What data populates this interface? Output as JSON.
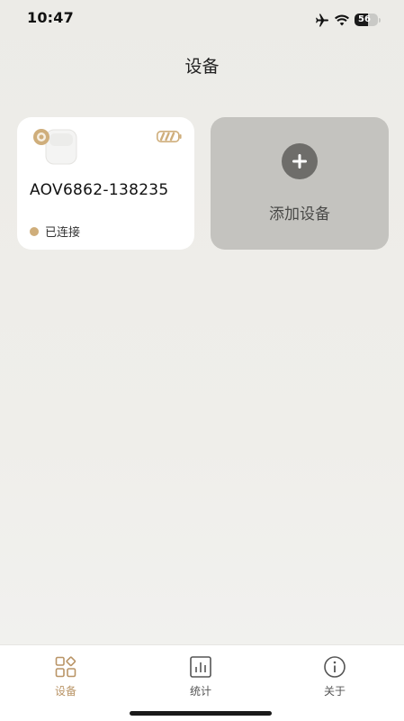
{
  "status_bar": {
    "time": "10:47",
    "battery": "56",
    "battery_level": 0.56,
    "icons": [
      "airplane-icon",
      "wifi-icon",
      "battery-icon"
    ]
  },
  "header": {
    "title": "设备"
  },
  "device_card": {
    "name": "AOV6862-138235",
    "status": "已连接",
    "status_color": "#cfae7b",
    "image_icon": "earbuds-case-icon",
    "battery_icon": "battery-outline-icon"
  },
  "add_card": {
    "label": "添加设备",
    "icon": "plus-icon"
  },
  "nav": {
    "items": [
      {
        "label": "设备",
        "icon": "grid-icon",
        "active": true
      },
      {
        "label": "统计",
        "icon": "chart-icon",
        "active": false
      },
      {
        "label": "关于",
        "icon": "info-icon",
        "active": false
      }
    ]
  },
  "colors": {
    "accent": "#b99466",
    "background": "#eeede9",
    "card": "#ffffff",
    "add_card": "#c4c3bf"
  }
}
